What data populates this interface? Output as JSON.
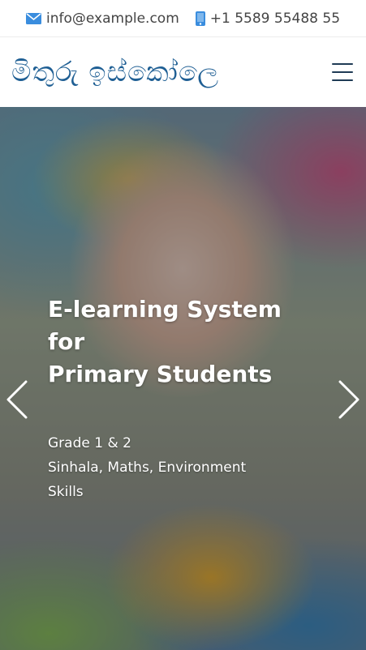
{
  "topbar": {
    "email": "info@example.com",
    "phone": "+1 5589 55488 55"
  },
  "header": {
    "logo_text": "මිතුරු ඉස්කෝලෙ"
  },
  "hero": {
    "headline": [
      "E-learning System",
      "for",
      "Primary Students"
    ],
    "sub": [
      "Grade 1 & 2",
      "Sinhala, Maths, Environment",
      "Skills"
    ]
  },
  "colors": {
    "accent": "#1f5f94",
    "icon": "#3a8dde"
  }
}
